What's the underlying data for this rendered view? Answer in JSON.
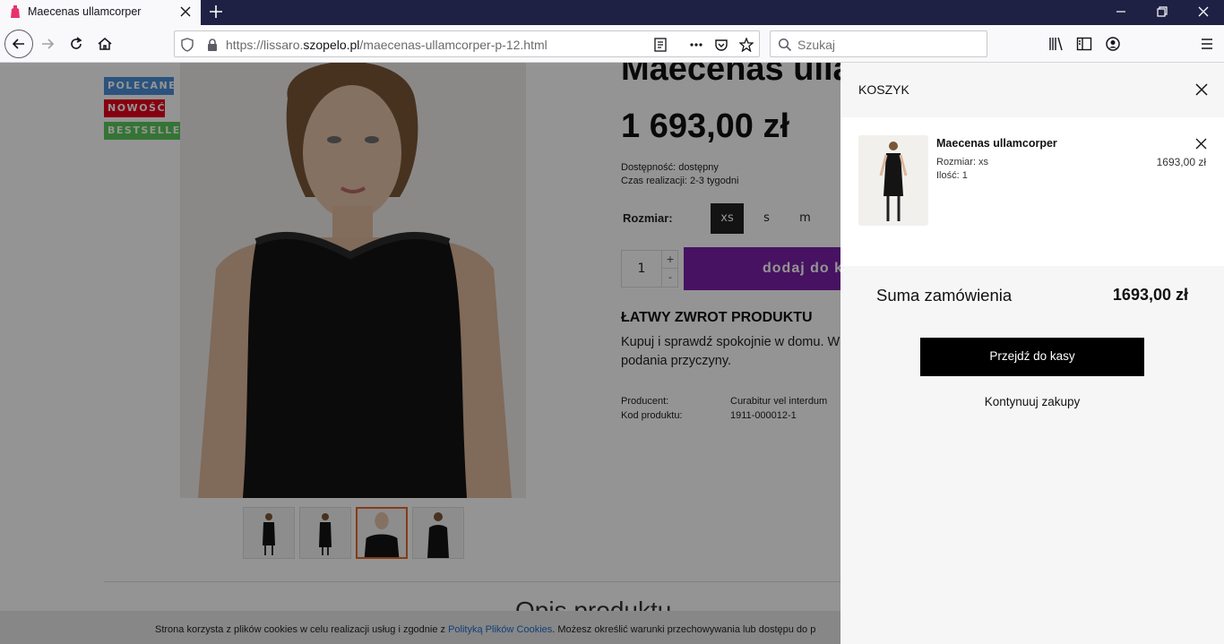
{
  "browser": {
    "tab_title": "Maecenas ullamcorper",
    "url_prefix": "https://lissaro.",
    "url_domain": "szopelo.pl",
    "url_path": "/maecenas-ullamcorper-p-12.html",
    "search_placeholder": "Szukaj",
    "favicon_icon": "dress-icon"
  },
  "product": {
    "badges": [
      "POLECANE",
      "NOWOŚĆ",
      "BESTSELLER"
    ],
    "title": "Maecenas ulla",
    "price": "1 693,00 zł",
    "availability": "Dostępność: dostępny",
    "lead_time": "Czas realizacji: 2-3 tygodni",
    "size_label": "Rozmiar:",
    "sizes": [
      "xs",
      "s",
      "m"
    ],
    "selected_size": "xs",
    "quantity": "1",
    "qty_plus": "+",
    "qty_minus": "-",
    "add_to_cart": "dodaj do k",
    "return_title": "ŁATWY ZWROT PRODUKTU",
    "return_text": "Kupuj i sprawdź spokojnie w domu. W podania przyczyny.",
    "return_line1": "Kupuj i sprawdź spokojnie w domu. W",
    "return_line2": "podania przyczyny.",
    "specs": [
      {
        "label": "Producent:",
        "value": "Curabitur vel interdum"
      },
      {
        "label": "Kod produktu:",
        "value": "1911-000012-1"
      }
    ],
    "description_title": "Opis produktu",
    "active_thumb": 3
  },
  "cookie": {
    "text_before": "Strona korzysta z plików cookies w celu realizacji usług i zgodnie z ",
    "link": "Polityką Plików Cookies",
    "text_after": ". Możesz określić warunki przechowywania lub dostępu do p"
  },
  "cart": {
    "title": "KOSZYK",
    "item_name": "Maecenas ullamcorper",
    "item_size": "Rozmiar: xs",
    "item_qty": "Ilość: 1",
    "item_price": "1693,00 zł",
    "sum_label": "Suma zamówienia",
    "sum_value": "1693,00 zł",
    "checkout": "Przejdź do kasy",
    "continue": "Kontynuuj zakupy"
  },
  "colors": {
    "accent_purple": "#7a1fa8",
    "badge_blue": "#4a90d9",
    "badge_red": "#e8001c",
    "badge_green": "#5cc85c",
    "browser_dark": "#1f2144"
  }
}
